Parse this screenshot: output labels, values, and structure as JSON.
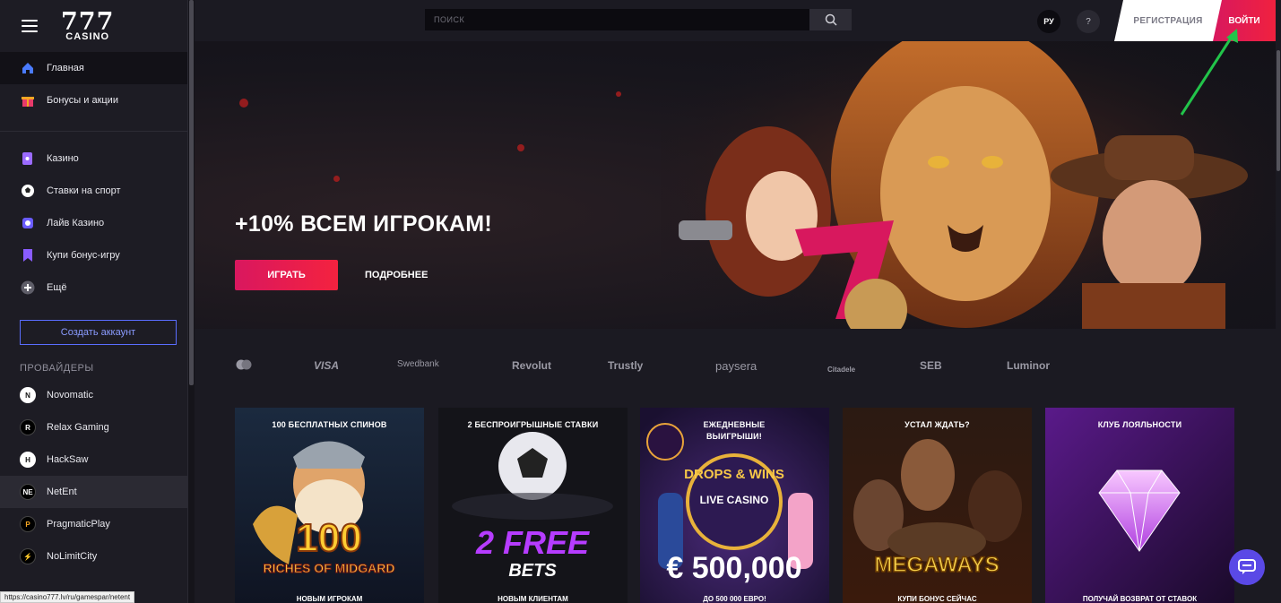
{
  "sidebar": {
    "logo_number": "777",
    "logo_word": "CASINO",
    "nav_primary": [
      {
        "label": "Главная",
        "icon": "home-icon",
        "active": true
      },
      {
        "label": "Бонусы и акции",
        "icon": "gift-icon"
      }
    ],
    "nav_secondary": [
      {
        "label": "Казино",
        "icon": "cards-icon"
      },
      {
        "label": "Ставки на спорт",
        "icon": "soccer-ball-icon"
      },
      {
        "label": "Лайв Казино",
        "icon": "live-icon"
      },
      {
        "label": "Купи бонус-игру",
        "icon": "bonus-game-icon"
      },
      {
        "label": "Ещё",
        "icon": "plus-circle-icon"
      }
    ],
    "create_account": "Создать аккаунт",
    "providers_title": "ПРОВАЙДЕРЫ",
    "providers": [
      {
        "label": "Novomatic",
        "badge": "N"
      },
      {
        "label": "Relax Gaming",
        "badge": "R"
      },
      {
        "label": "HackSaw",
        "badge": "H"
      },
      {
        "label": "NetEnt",
        "badge": "NE"
      },
      {
        "label": "PragmaticPlay",
        "badge": "P"
      },
      {
        "label": "NoLimitCity",
        "badge": "⚡"
      }
    ]
  },
  "header": {
    "search_placeholder": "ПОИСК",
    "lang": "РУ",
    "help": "?",
    "register": "РЕГИСТРАЦИЯ",
    "login": "ВОЙТИ"
  },
  "hero": {
    "title": "+10% ВСЕМ ИГРОКАМ!",
    "play": "ИГРАТЬ",
    "more": "ПОДРОБНЕЕ"
  },
  "payments": [
    "VISA",
    "Swedbank",
    "Revolut",
    "Trustly",
    "paysera",
    "Citadele",
    "SEB",
    "Luminor"
  ],
  "promos": [
    {
      "title": "100 БЕСПЛАТНЫХ СПИНОВ",
      "art_big": "100",
      "art_small": "RICHES OF MIDGARD",
      "bottom": "НОВЫМ ИГРОКАМ"
    },
    {
      "title": "2 БЕСПРОИГРЫШНЫЕ СТАВКИ",
      "art_big": "2 FREE",
      "art_small": "BETS",
      "bottom": "НОВЫМ КЛИЕНТАМ"
    },
    {
      "title": "ЕЖЕДНЕВНЫЕ ВЫИГРЫШИ!",
      "art_badge": "DROPS & WINS",
      "art_mid": "LIVE CASINO",
      "art_big": "€ 500,000",
      "bottom": "ДО 500 000 ЕВРО!"
    },
    {
      "title": "УСТАЛ ЖДАТЬ?",
      "art_big": "MEGAWAYS",
      "bottom": "КУПИ БОНУС СЕЙЧАС"
    },
    {
      "title": "КЛУБ ЛОЯЛЬНОСТИ",
      "bottom": "ПОЛУЧАЙ ВОЗВРАТ ОТ СТАВОК"
    }
  ],
  "status_url": "https://casino777.lv/ru/gamespar/netent",
  "colors": {
    "accent_red": "#e81c4f",
    "accent_blue": "#5a6dff",
    "chat": "#5a49e6",
    "annotation_arrow": "#22c44a"
  }
}
